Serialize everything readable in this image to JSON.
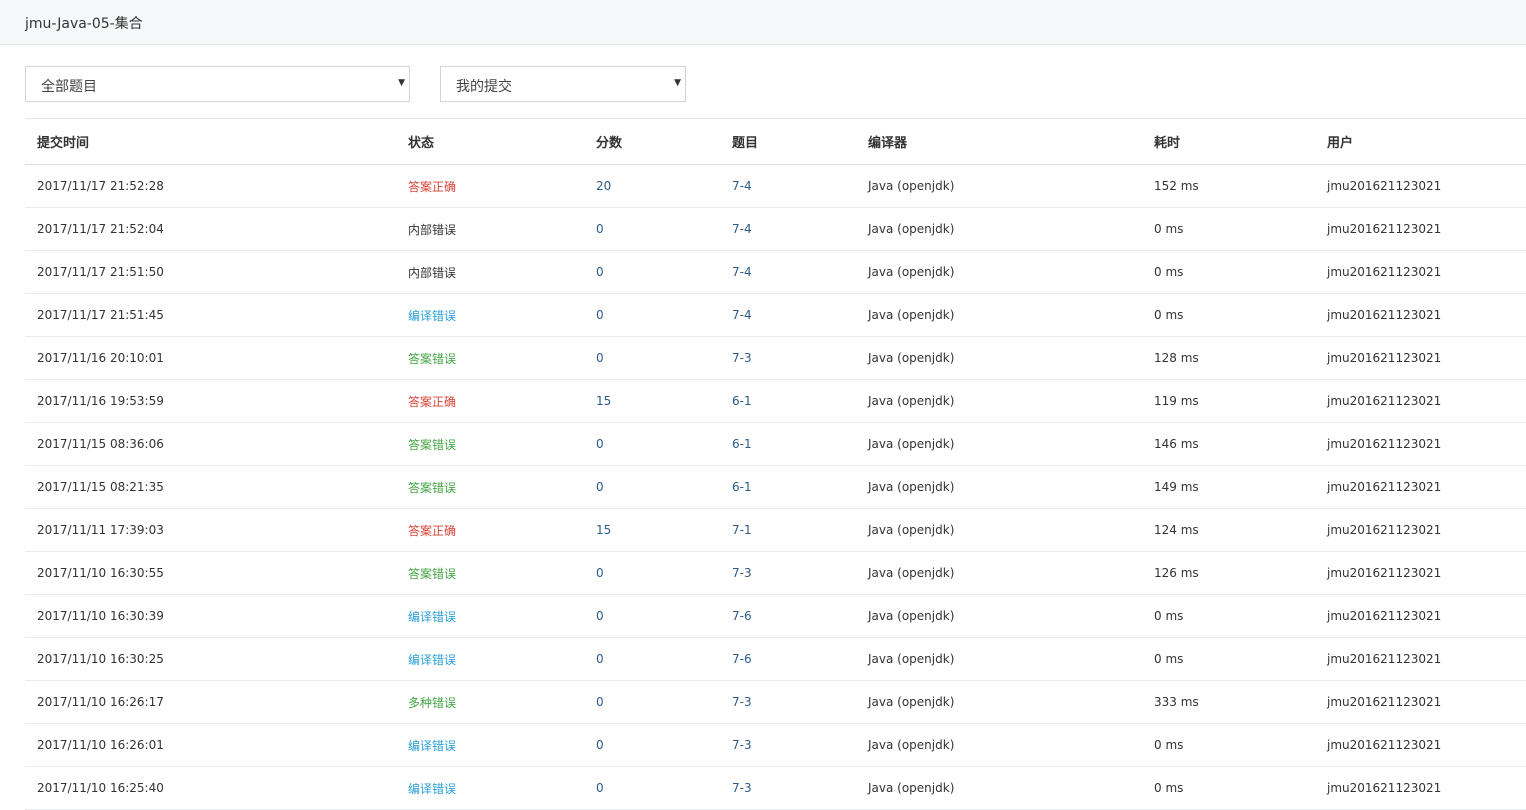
{
  "header": {
    "title": "jmu-Java-05-集合"
  },
  "filters": {
    "problem_select": "全部题目",
    "submission_select": "我的提交"
  },
  "table": {
    "columns": [
      "提交时间",
      "状态",
      "分数",
      "题目",
      "编译器",
      "耗时",
      "用户"
    ],
    "rows": [
      {
        "time": "2017/11/17 21:52:28",
        "status": "答案正确",
        "status_type": "red",
        "score": "20",
        "problem": "7-4",
        "compiler": "Java (openjdk)",
        "duration": "152 ms",
        "user": "jmu201621123021"
      },
      {
        "time": "2017/11/17 21:52:04",
        "status": "内部错误",
        "status_type": "gray",
        "score": "0",
        "problem": "7-4",
        "compiler": "Java (openjdk)",
        "duration": "0 ms",
        "user": "jmu201621123021"
      },
      {
        "time": "2017/11/17 21:51:50",
        "status": "内部错误",
        "status_type": "gray",
        "score": "0",
        "problem": "7-4",
        "compiler": "Java (openjdk)",
        "duration": "0 ms",
        "user": "jmu201621123021"
      },
      {
        "time": "2017/11/17 21:51:45",
        "status": "编译错误",
        "status_type": "blue",
        "score": "0",
        "problem": "7-4",
        "compiler": "Java (openjdk)",
        "duration": "0 ms",
        "user": "jmu201621123021"
      },
      {
        "time": "2017/11/16 20:10:01",
        "status": "答案错误",
        "status_type": "green",
        "score": "0",
        "problem": "7-3",
        "compiler": "Java (openjdk)",
        "duration": "128 ms",
        "user": "jmu201621123021"
      },
      {
        "time": "2017/11/16 19:53:59",
        "status": "答案正确",
        "status_type": "red",
        "score": "15",
        "problem": "6-1",
        "compiler": "Java (openjdk)",
        "duration": "119 ms",
        "user": "jmu201621123021"
      },
      {
        "time": "2017/11/15 08:36:06",
        "status": "答案错误",
        "status_type": "green",
        "score": "0",
        "problem": "6-1",
        "compiler": "Java (openjdk)",
        "duration": "146 ms",
        "user": "jmu201621123021"
      },
      {
        "time": "2017/11/15 08:21:35",
        "status": "答案错误",
        "status_type": "green",
        "score": "0",
        "problem": "6-1",
        "compiler": "Java (openjdk)",
        "duration": "149 ms",
        "user": "jmu201621123021"
      },
      {
        "time": "2017/11/11 17:39:03",
        "status": "答案正确",
        "status_type": "red",
        "score": "15",
        "problem": "7-1",
        "compiler": "Java (openjdk)",
        "duration": "124 ms",
        "user": "jmu201621123021"
      },
      {
        "time": "2017/11/10 16:30:55",
        "status": "答案错误",
        "status_type": "green",
        "score": "0",
        "problem": "7-3",
        "compiler": "Java (openjdk)",
        "duration": "126 ms",
        "user": "jmu201621123021"
      },
      {
        "time": "2017/11/10 16:30:39",
        "status": "编译错误",
        "status_type": "blue",
        "score": "0",
        "problem": "7-6",
        "compiler": "Java (openjdk)",
        "duration": "0 ms",
        "user": "jmu201621123021"
      },
      {
        "time": "2017/11/10 16:30:25",
        "status": "编译错误",
        "status_type": "blue",
        "score": "0",
        "problem": "7-6",
        "compiler": "Java (openjdk)",
        "duration": "0 ms",
        "user": "jmu201621123021"
      },
      {
        "time": "2017/11/10 16:26:17",
        "status": "多种错误",
        "status_type": "green",
        "score": "0",
        "problem": "7-3",
        "compiler": "Java (openjdk)",
        "duration": "333 ms",
        "user": "jmu201621123021"
      },
      {
        "time": "2017/11/10 16:26:01",
        "status": "编译错误",
        "status_type": "blue",
        "score": "0",
        "problem": "7-3",
        "compiler": "Java (openjdk)",
        "duration": "0 ms",
        "user": "jmu201621123021"
      },
      {
        "time": "2017/11/10 16:25:40",
        "status": "编译错误",
        "status_type": "blue",
        "score": "0",
        "problem": "7-3",
        "compiler": "Java (openjdk)",
        "duration": "0 ms",
        "user": "jmu201621123021"
      }
    ]
  },
  "colors": {
    "status_correct": "#d9443a",
    "status_wrong": "#46a546",
    "status_compile_error": "#2b9fd6",
    "status_internal_error": "#333333",
    "link": "#2b5a8a"
  }
}
